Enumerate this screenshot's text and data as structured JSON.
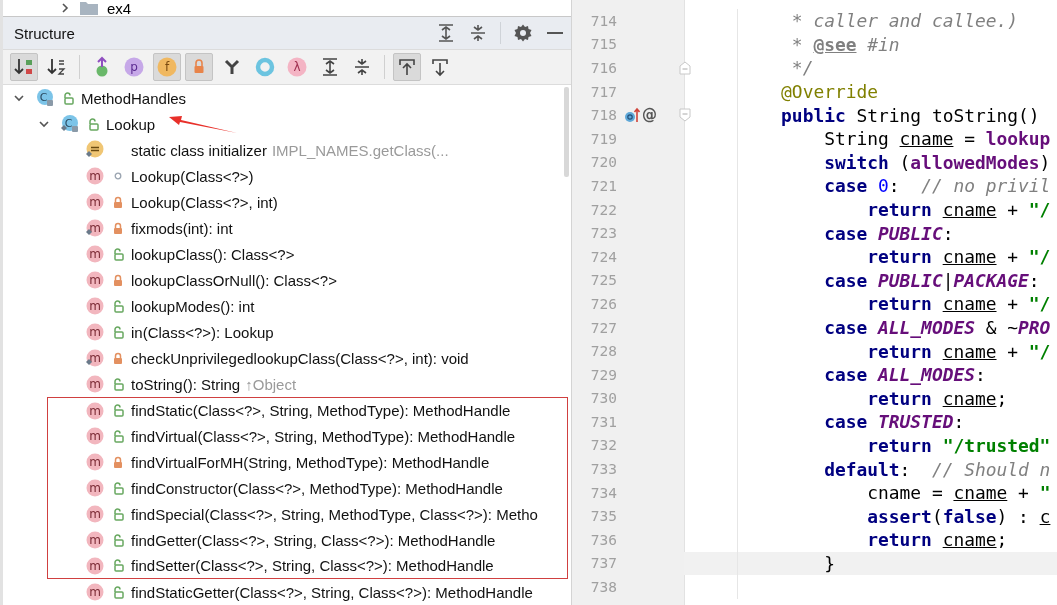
{
  "project_tree": {
    "partial_row": {
      "label": "ex4",
      "expanded": false
    }
  },
  "structure": {
    "title": "Structure",
    "toolbar_groups": [
      [
        {
          "kind": "visibility",
          "selected": true
        },
        {
          "kind": "alphabetical",
          "selected": false
        }
      ],
      [
        {
          "kind": "inherited",
          "selected": false
        },
        {
          "kind": "properties",
          "glyph": "p",
          "selected": false
        },
        {
          "kind": "fields",
          "glyph": "f",
          "selected": true
        },
        {
          "kind": "nonpublic",
          "selected": true
        },
        {
          "kind": "anonymous",
          "selected": false
        },
        {
          "kind": "ring",
          "selected": false
        },
        {
          "kind": "lambdas",
          "glyph": "λ",
          "selected": false
        },
        {
          "kind": "expand",
          "selected": false
        },
        {
          "kind": "collapse",
          "selected": false
        }
      ],
      [
        {
          "kind": "scrollto",
          "selected": true
        },
        {
          "kind": "scrollfrom",
          "selected": false
        }
      ]
    ],
    "tree": [
      {
        "kind": "class",
        "badge": "C",
        "private": false,
        "package_private": false,
        "static": false,
        "label": "MethodHandles",
        "expanded": true,
        "highlighted": false,
        "children": [
          {
            "kind": "class",
            "badge": "C",
            "private": false,
            "package_private": false,
            "static": true,
            "label": "Lookup",
            "expanded": true,
            "arrow": true,
            "highlighted": false,
            "children": [
              {
                "kind": "initializer",
                "static": true,
                "label": "static class initializer",
                "detail": "IMPL_NAMES.getClass(...",
                "highlighted": false
              },
              {
                "kind": "method",
                "badge": "m",
                "private": false,
                "package_private": true,
                "static": false,
                "label": "Lookup(Class<?>)",
                "highlighted": false
              },
              {
                "kind": "method",
                "badge": "m",
                "private": true,
                "package_private": false,
                "static": false,
                "label": "Lookup(Class<?>, int)",
                "highlighted": false
              },
              {
                "kind": "method",
                "badge": "m",
                "private": true,
                "package_private": false,
                "static": true,
                "label": "fixmods(int): int",
                "highlighted": false
              },
              {
                "kind": "method",
                "badge": "m",
                "private": false,
                "package_private": false,
                "static": false,
                "label": "lookupClass(): Class<?>",
                "highlighted": false
              },
              {
                "kind": "method",
                "badge": "m",
                "private": true,
                "package_private": false,
                "static": false,
                "label": "lookupClassOrNull(): Class<?>",
                "highlighted": false
              },
              {
                "kind": "method",
                "badge": "m",
                "private": false,
                "package_private": false,
                "static": false,
                "label": "lookupModes(): int",
                "highlighted": false
              },
              {
                "kind": "method",
                "badge": "m",
                "private": false,
                "package_private": false,
                "static": false,
                "label": "in(Class<?>): Lookup",
                "highlighted": false
              },
              {
                "kind": "method",
                "badge": "m",
                "private": true,
                "package_private": false,
                "static": true,
                "label": "checkUnprivilegedlookupClass(Class<?>, int): void",
                "highlighted": false
              },
              {
                "kind": "method",
                "badge": "m",
                "private": false,
                "package_private": false,
                "static": false,
                "label": "toString(): String",
                "detail": "↑Object",
                "highlighted": false
              },
              {
                "kind": "method",
                "badge": "m",
                "private": false,
                "package_private": false,
                "static": false,
                "label": "findStatic(Class<?>, String, MethodType): MethodHandle",
                "highlighted": true
              },
              {
                "kind": "method",
                "badge": "m",
                "private": false,
                "package_private": false,
                "static": false,
                "label": "findVirtual(Class<?>, String, MethodType): MethodHandle",
                "highlighted": true
              },
              {
                "kind": "method",
                "badge": "m",
                "private": true,
                "package_private": false,
                "static": false,
                "label": "findVirtualForMH(String, MethodType): MethodHandle",
                "highlighted": true
              },
              {
                "kind": "method",
                "badge": "m",
                "private": false,
                "package_private": false,
                "static": false,
                "label": "findConstructor(Class<?>, MethodType): MethodHandle",
                "highlighted": true
              },
              {
                "kind": "method",
                "badge": "m",
                "private": false,
                "package_private": false,
                "static": false,
                "label": "findSpecial(Class<?>, String, MethodType, Class<?>): Metho",
                "highlighted": true
              },
              {
                "kind": "method",
                "badge": "m",
                "private": false,
                "package_private": false,
                "static": false,
                "label": "findGetter(Class<?>, String, Class<?>): MethodHandle",
                "highlighted": true
              },
              {
                "kind": "method",
                "badge": "m",
                "private": false,
                "package_private": false,
                "static": false,
                "label": "findSetter(Class<?>, String, Class<?>): MethodHandle",
                "highlighted": true
              },
              {
                "kind": "method",
                "badge": "m",
                "private": false,
                "package_private": false,
                "static": false,
                "label": "findStaticGetter(Class<?>, String, Class<?>): MethodHandle",
                "highlighted": false
              }
            ]
          }
        ]
      }
    ]
  },
  "editor": {
    "lines": [
      {
        "number": "714",
        "override": false,
        "current": false,
        "tokens": [
          {
            "kind": "comment",
            "text": "     * caller and callee.)"
          }
        ]
      },
      {
        "number": "715",
        "override": false,
        "current": false,
        "tokens": [
          {
            "kind": "comment",
            "text": "     * "
          },
          {
            "kind": "doctag",
            "text": "@see"
          },
          {
            "kind": "comment",
            "text": " #in"
          }
        ]
      },
      {
        "number": "716",
        "override": false,
        "current": false,
        "fold_end": true,
        "tokens": [
          {
            "kind": "comment",
            "text": "     */"
          }
        ]
      },
      {
        "number": "717",
        "override": false,
        "current": false,
        "tokens": [
          {
            "kind": "annotation",
            "text": "    @Override"
          }
        ]
      },
      {
        "number": "718",
        "override": true,
        "gutter_text": "@",
        "current": false,
        "fold_start": true,
        "tokens": [
          {
            "kind": "keyword",
            "text": "    public"
          },
          {
            "kind": "plain",
            "text": " String toString()"
          }
        ]
      },
      {
        "number": "719",
        "override": false,
        "current": false,
        "tokens": [
          {
            "kind": "plain",
            "text": "        String "
          },
          {
            "kind": "variable",
            "text": "cname"
          },
          {
            "kind": "plain",
            "text": " = "
          },
          {
            "kind": "field",
            "text": "lookup"
          }
        ]
      },
      {
        "number": "720",
        "override": false,
        "current": false,
        "tokens": [
          {
            "kind": "keyword",
            "text": "        switch"
          },
          {
            "kind": "plain",
            "text": " ("
          },
          {
            "kind": "field",
            "text": "allowedModes"
          },
          {
            "kind": "plain",
            "text": ")"
          }
        ]
      },
      {
        "number": "721",
        "override": false,
        "current": false,
        "tokens": [
          {
            "kind": "keyword",
            "text": "        case "
          },
          {
            "kind": "number",
            "text": "0"
          },
          {
            "kind": "plain",
            "text": ":  "
          },
          {
            "kind": "comment",
            "text": "// no privil"
          }
        ]
      },
      {
        "number": "722",
        "override": false,
        "current": false,
        "tokens": [
          {
            "kind": "keyword",
            "text": "            return "
          },
          {
            "kind": "variable",
            "text": "cname"
          },
          {
            "kind": "plain",
            "text": " + "
          },
          {
            "kind": "string",
            "text": "\"/"
          }
        ]
      },
      {
        "number": "723",
        "override": false,
        "current": false,
        "tokens": [
          {
            "kind": "keyword",
            "text": "        case "
          },
          {
            "kind": "constant",
            "text": "PUBLIC"
          },
          {
            "kind": "plain",
            "text": ":"
          }
        ]
      },
      {
        "number": "724",
        "override": false,
        "current": false,
        "tokens": [
          {
            "kind": "keyword",
            "text": "            return "
          },
          {
            "kind": "variable",
            "text": "cname"
          },
          {
            "kind": "plain",
            "text": " + "
          },
          {
            "kind": "string",
            "text": "\"/"
          }
        ]
      },
      {
        "number": "725",
        "override": false,
        "current": false,
        "tokens": [
          {
            "kind": "keyword",
            "text": "        case "
          },
          {
            "kind": "constant",
            "text": "PUBLIC"
          },
          {
            "kind": "plain",
            "text": "|"
          },
          {
            "kind": "constant",
            "text": "PACKAGE"
          },
          {
            "kind": "plain",
            "text": ":"
          }
        ]
      },
      {
        "number": "726",
        "override": false,
        "current": false,
        "tokens": [
          {
            "kind": "keyword",
            "text": "            return "
          },
          {
            "kind": "variable",
            "text": "cname"
          },
          {
            "kind": "plain",
            "text": " + "
          },
          {
            "kind": "string",
            "text": "\"/"
          }
        ]
      },
      {
        "number": "727",
        "override": false,
        "current": false,
        "tokens": [
          {
            "kind": "keyword",
            "text": "        case "
          },
          {
            "kind": "constant",
            "text": "ALL_MODES"
          },
          {
            "kind": "plain",
            "text": " & ~"
          },
          {
            "kind": "constant",
            "text": "PRO"
          }
        ]
      },
      {
        "number": "728",
        "override": false,
        "current": false,
        "tokens": [
          {
            "kind": "keyword",
            "text": "            return "
          },
          {
            "kind": "variable",
            "text": "cname"
          },
          {
            "kind": "plain",
            "text": " + "
          },
          {
            "kind": "string",
            "text": "\"/"
          }
        ]
      },
      {
        "number": "729",
        "override": false,
        "current": false,
        "tokens": [
          {
            "kind": "keyword",
            "text": "        case "
          },
          {
            "kind": "constant",
            "text": "ALL_MODES"
          },
          {
            "kind": "plain",
            "text": ":"
          }
        ]
      },
      {
        "number": "730",
        "override": false,
        "current": false,
        "tokens": [
          {
            "kind": "keyword",
            "text": "            return "
          },
          {
            "kind": "variable",
            "text": "cname"
          },
          {
            "kind": "plain",
            "text": ";"
          }
        ]
      },
      {
        "number": "731",
        "override": false,
        "current": false,
        "tokens": [
          {
            "kind": "keyword",
            "text": "        case "
          },
          {
            "kind": "constant",
            "text": "TRUSTED"
          },
          {
            "kind": "plain",
            "text": ":"
          }
        ]
      },
      {
        "number": "732",
        "override": false,
        "current": false,
        "tokens": [
          {
            "kind": "keyword",
            "text": "            return "
          },
          {
            "kind": "string",
            "text": "\"/trusted\""
          }
        ]
      },
      {
        "number": "733",
        "override": false,
        "current": false,
        "tokens": [
          {
            "kind": "keyword",
            "text": "        default"
          },
          {
            "kind": "plain",
            "text": ":  "
          },
          {
            "kind": "comment",
            "text": "// Should n"
          }
        ]
      },
      {
        "number": "734",
        "override": false,
        "current": false,
        "tokens": [
          {
            "kind": "plain",
            "text": "            cname"
          },
          {
            "kind": "plain",
            "text": " = "
          },
          {
            "kind": "variable",
            "text": "cname"
          },
          {
            "kind": "plain",
            "text": " + "
          },
          {
            "kind": "string",
            "text": "\""
          }
        ]
      },
      {
        "number": "735",
        "override": false,
        "current": false,
        "tokens": [
          {
            "kind": "keyword",
            "text": "            assert"
          },
          {
            "kind": "plain",
            "text": "("
          },
          {
            "kind": "keyword",
            "text": "false"
          },
          {
            "kind": "plain",
            "text": ") : "
          },
          {
            "kind": "variable",
            "text": "c"
          }
        ]
      },
      {
        "number": "736",
        "override": false,
        "current": false,
        "tokens": [
          {
            "kind": "keyword",
            "text": "            return "
          },
          {
            "kind": "variable",
            "text": "cname"
          },
          {
            "kind": "plain",
            "text": ";"
          }
        ]
      },
      {
        "number": "737",
        "override": false,
        "current": true,
        "tokens": [
          {
            "kind": "plain",
            "text": "        }"
          }
        ]
      },
      {
        "number": "738",
        "override": false,
        "current": false
      }
    ]
  }
}
